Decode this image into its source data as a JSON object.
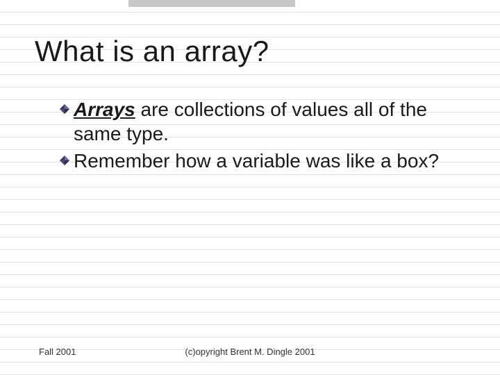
{
  "title": "What is an array?",
  "bullets": {
    "b1": {
      "emph": "Arrays",
      "rest": " are collections of values all of the same type."
    },
    "b2": {
      "text": "Remember how a variable was like a box?"
    }
  },
  "footer": {
    "left": "Fall 2001",
    "center": "(c)opyright Brent M. Dingle 2001"
  },
  "icons": {
    "bullet": "diamond-bullet-icon"
  }
}
